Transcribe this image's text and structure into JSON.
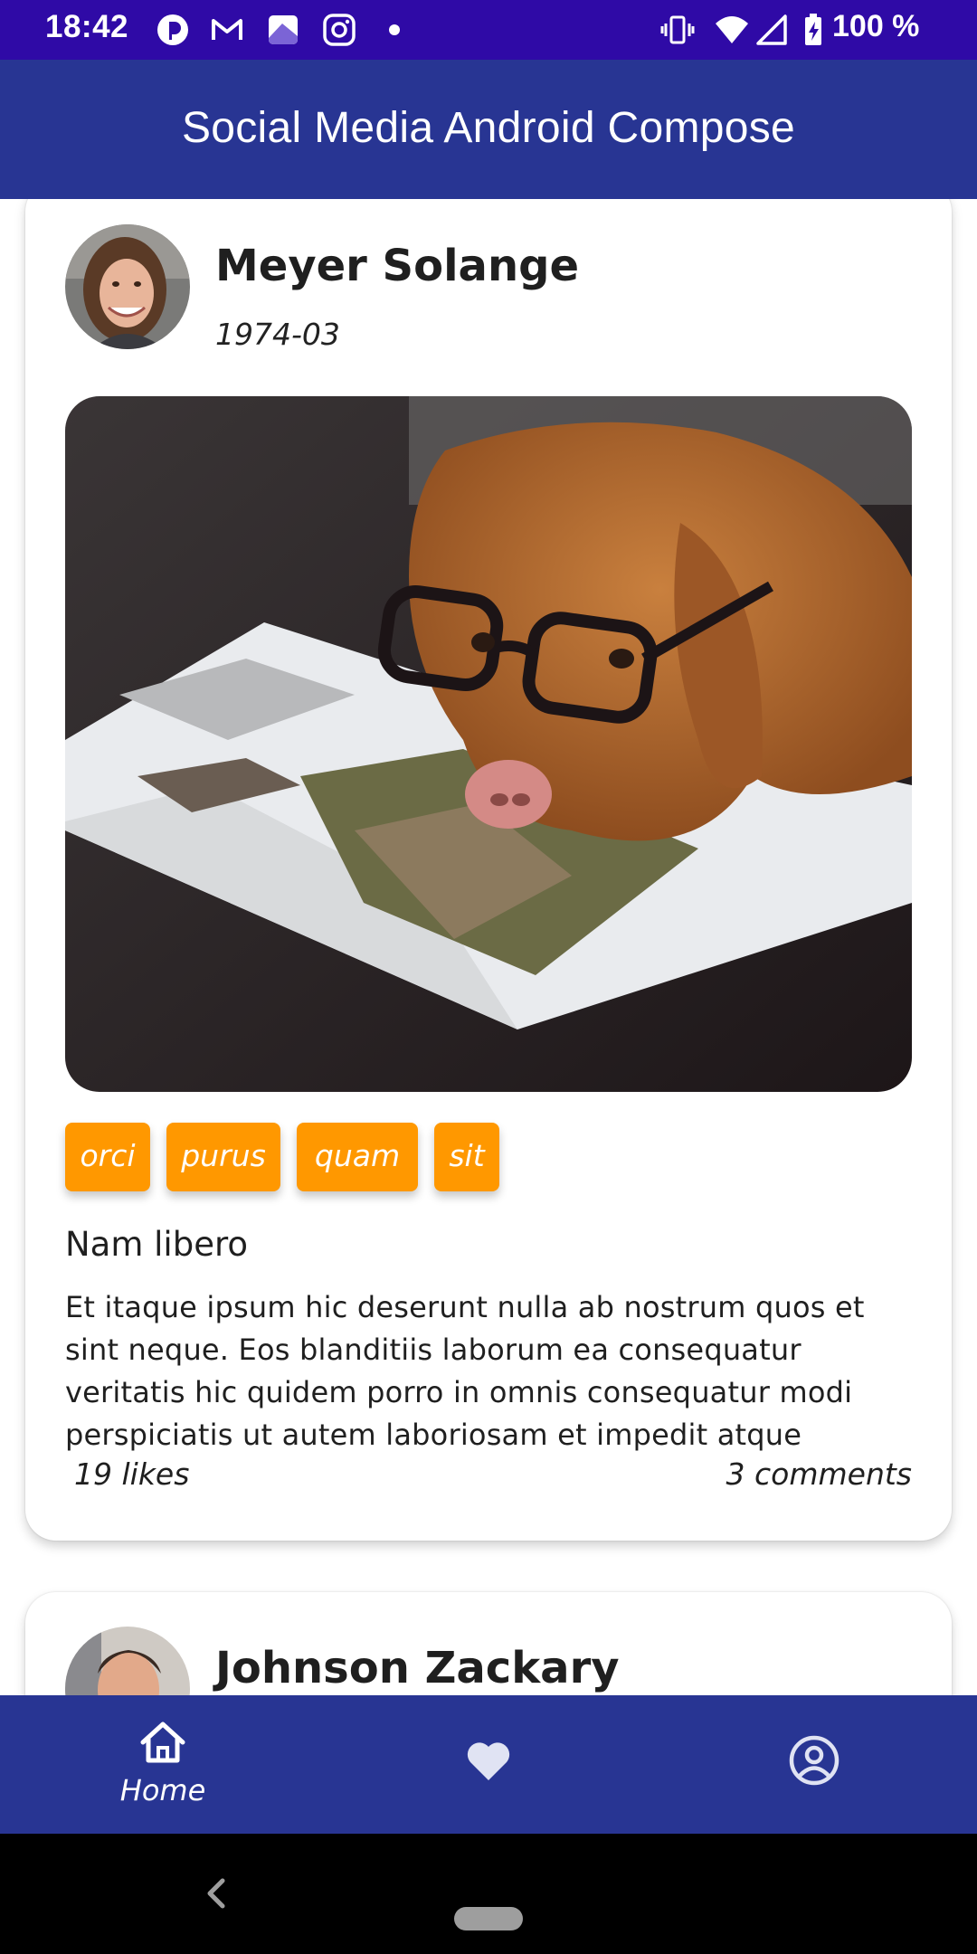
{
  "status_bar": {
    "time": "18:42",
    "battery": "100 %",
    "notification_icons": [
      "pocket-casts-icon",
      "gmail-icon",
      "gallery-icon",
      "instagram-icon",
      "more-dot-icon"
    ],
    "system_icons": [
      "vibrate-icon",
      "wifi-icon",
      "signal-icon",
      "battery-charging-icon"
    ]
  },
  "app_bar": {
    "title": "Social Media Android Compose"
  },
  "posts": [
    {
      "author": "Meyer Solange",
      "date": "1974-03",
      "tags": [
        "orci",
        "purus",
        "quam",
        "sit"
      ],
      "title": "Nam libero",
      "body": "Et itaque ipsum hic deserunt nulla ab nostrum quos et sint neque. Eos blanditiis laborum ea consequatur veritatis hic quidem porro in omnis consequatur modi perspiciatis ut autem laboriosam et impedit atque",
      "likes": "19 likes",
      "comments": "3 comments"
    },
    {
      "author": "Johnson Zackary"
    }
  ],
  "bottom_nav": {
    "items": [
      {
        "label": "Home",
        "icon": "home-icon",
        "selected": true
      },
      {
        "label": "",
        "icon": "heart-icon",
        "selected": false
      },
      {
        "label": "",
        "icon": "account-circle-icon",
        "selected": false
      }
    ]
  },
  "colors": {
    "status_bar": "#2f0aa6",
    "primary": "#283593",
    "tag": "#ff9800",
    "text": "#1f1f1f"
  }
}
